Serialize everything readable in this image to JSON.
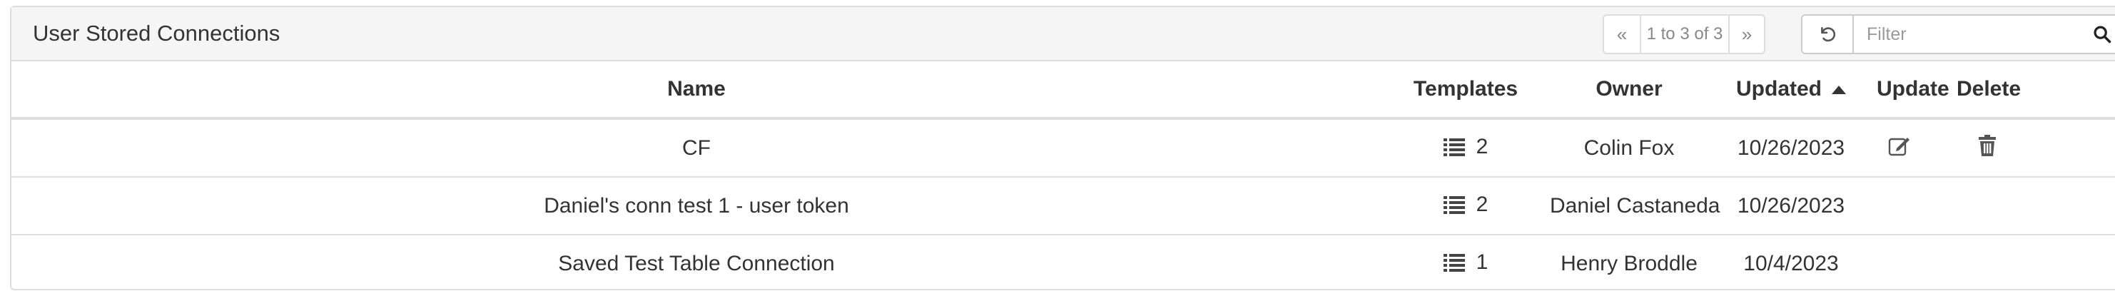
{
  "panel": {
    "title": "User Stored Connections"
  },
  "pager": {
    "prev": "«",
    "info": "1 to 3 of 3",
    "next": "»"
  },
  "filter": {
    "placeholder": "Filter"
  },
  "table": {
    "columns": {
      "name": "Name",
      "templates": "Templates",
      "owner": "Owner",
      "updated": "Updated",
      "update": "Update",
      "delete": "Delete"
    },
    "sort": {
      "column": "updated",
      "direction": "ascending"
    },
    "rows": [
      {
        "name": "CF",
        "templates": "2",
        "owner": "Colin Fox",
        "updated": "10/26/2023",
        "can_edit": true
      },
      {
        "name": "Daniel's conn test 1 - user token",
        "templates": "2",
        "owner": "Daniel Castaneda",
        "updated": "10/26/2023",
        "can_edit": false
      },
      {
        "name": "Saved Test Table Connection",
        "templates": "1",
        "owner": "Henry Broddle",
        "updated": "10/4/2023",
        "can_edit": false
      }
    ]
  },
  "icons": {
    "reset": "undo-icon",
    "search": "search-icon",
    "sort": "sort-up-icon",
    "templates": "list-icon",
    "edit": "edit-icon",
    "delete": "trash-icon"
  },
  "colors": {
    "header_bg": "#f5f5f5",
    "border": "#dddddd",
    "text": "#333333",
    "muted": "#888888"
  }
}
